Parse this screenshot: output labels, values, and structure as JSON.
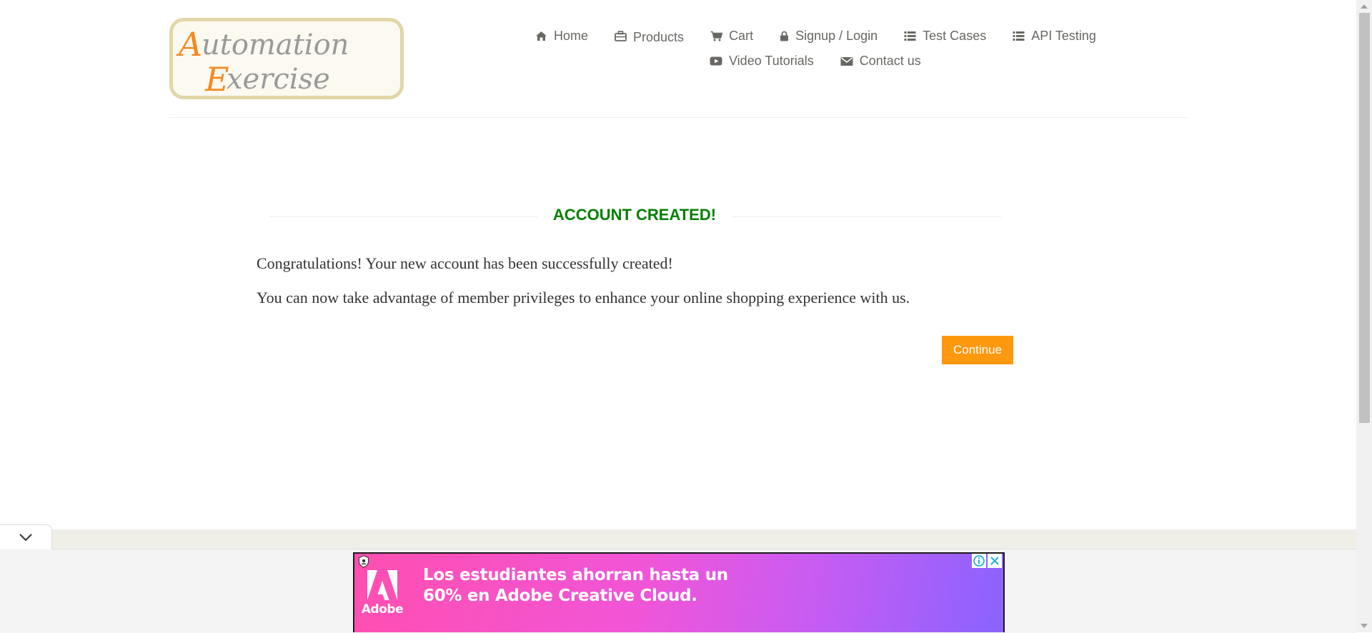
{
  "logo": {
    "line1_initial": "A",
    "line1_rest": "utomation",
    "line2_initial": "E",
    "line2_rest": "xercise"
  },
  "nav": {
    "home": "Home",
    "products": "Products",
    "cart": "Cart",
    "signup_login": "Signup / Login",
    "test_cases": "Test Cases",
    "api_testing": "API Testing",
    "video_tutorials": "Video Tutorials",
    "contact_us": "Contact us"
  },
  "main": {
    "title": "ACCOUNT CREATED!",
    "message1": "Congratulations! Your new account has been successfully created!",
    "message2": "You can now take advantage of member privileges to enhance your online shopping experience with us.",
    "continue_label": "Continue"
  },
  "ad": {
    "headline_line1": "Los estudiantes ahorran hasta un",
    "headline_line2": "60% en Adobe Creative Cloud.",
    "brand": "Adobe"
  },
  "colors": {
    "title_green": "#008000",
    "button_orange": "#fe980f",
    "logo_orange": "#f58a1f",
    "nav_text": "#696763"
  },
  "icons": {
    "home": "home-icon",
    "products": "briefcase-icon",
    "cart": "shopping-cart-icon",
    "signup_login": "lock-icon",
    "test_cases": "list-icon",
    "api_testing": "list-icon",
    "video_tutorials": "youtube-play-icon",
    "contact_us": "envelope-icon",
    "collapse": "chevron-down-icon",
    "ad_info": "info-icon",
    "ad_close": "close-icon"
  }
}
